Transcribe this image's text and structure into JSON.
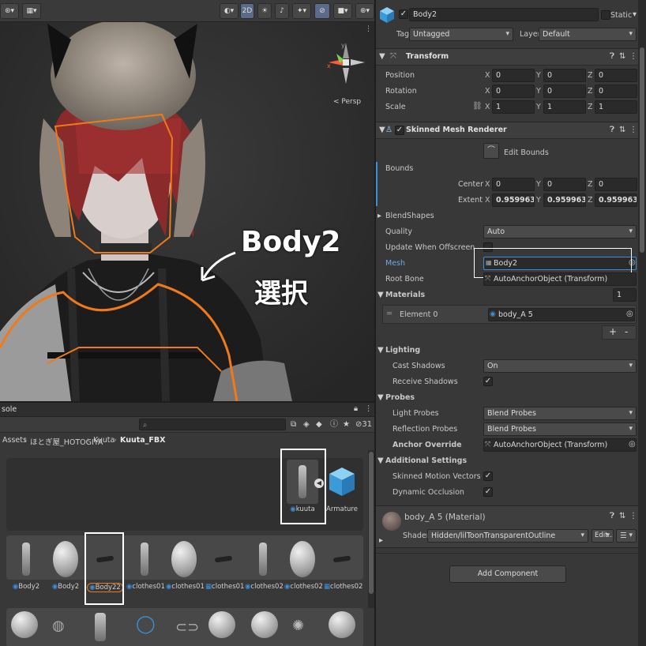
{
  "scene": {
    "toolbar": {
      "view_2d": "2D",
      "persp_label": "< Persp"
    },
    "annotation": {
      "line1": "Body2",
      "line2": "選択"
    }
  },
  "inspector": {
    "object_name": "Body2",
    "static_label": "Static",
    "tag_label": "Tag",
    "tag_value": "Untagged",
    "layer_label": "Layer",
    "layer_value": "Default",
    "transform": {
      "title": "Transform",
      "position_label": "Position",
      "rotation_label": "Rotation",
      "scale_label": "Scale",
      "position": [
        "0",
        "0",
        "0"
      ],
      "rotation": [
        "0",
        "0",
        "0"
      ],
      "scale": [
        "1",
        "1",
        "1"
      ],
      "x": "X",
      "y": "Y",
      "z": "Z"
    },
    "smr": {
      "title": "Skinned Mesh Renderer",
      "edit_bounds": "Edit Bounds",
      "bounds_label": "Bounds",
      "center_label": "Center",
      "extent_label": "Extent",
      "center": [
        "0",
        "0",
        "0"
      ],
      "extent": [
        "0.9599636",
        "0.9599636",
        "0.9599636"
      ],
      "blendshapes": "BlendShapes",
      "quality_label": "Quality",
      "quality_value": "Auto",
      "update_offscreen_label": "Update When Offscreen",
      "mesh_label": "Mesh",
      "mesh_value": "Body2",
      "root_bone_label": "Root Bone",
      "root_bone_value": "AutoAnchorObject (Transform)",
      "materials_label": "Materials",
      "materials_count": "1",
      "element0_label": "Element 0",
      "element0_value": "body_A 5",
      "plus": "+",
      "minus": "-",
      "lighting": "Lighting",
      "cast_shadows_label": "Cast Shadows",
      "cast_shadows_value": "On",
      "receive_shadows_label": "Receive Shadows",
      "probes": "Probes",
      "light_probes_label": "Light Probes",
      "light_probes_value": "Blend Probes",
      "reflection_probes_label": "Reflection Probes",
      "reflection_probes_value": "Blend Probes",
      "anchor_override_label": "Anchor Override",
      "anchor_override_value": "AutoAnchorObject (Transform)",
      "additional_settings": "Additional Settings",
      "skinned_motion_label": "Skinned Motion Vectors",
      "dynamic_occlusion_label": "Dynamic Occlusion"
    },
    "material": {
      "title": "body_A 5 (Material)",
      "shader_label": "Shader",
      "shader_value": "Hidden/lilToonTransparentOutline",
      "edit_label": "Edit..."
    },
    "add_component": "Add Component"
  },
  "project": {
    "tab": "sole",
    "badge": "31",
    "breadcrumb": [
      "Assets",
      "ほとぎ屋_HOTOGIYA",
      "Kuuta",
      "Kuuta_FBX"
    ],
    "top_assets": [
      {
        "name": "kuuta"
      },
      {
        "name": "Armature"
      }
    ],
    "row1": [
      {
        "name": "Body2"
      },
      {
        "name": "Body2"
      },
      {
        "name": "Body22"
      },
      {
        "name": "clothes01"
      },
      {
        "name": "clothes01"
      },
      {
        "name": "clothes01"
      },
      {
        "name": "clothes02"
      },
      {
        "name": "clothes02"
      },
      {
        "name": "clothes02"
      }
    ]
  },
  "colors": {
    "selection_outline": "#f07a1a",
    "accent_blue": "#3b8fd8"
  }
}
